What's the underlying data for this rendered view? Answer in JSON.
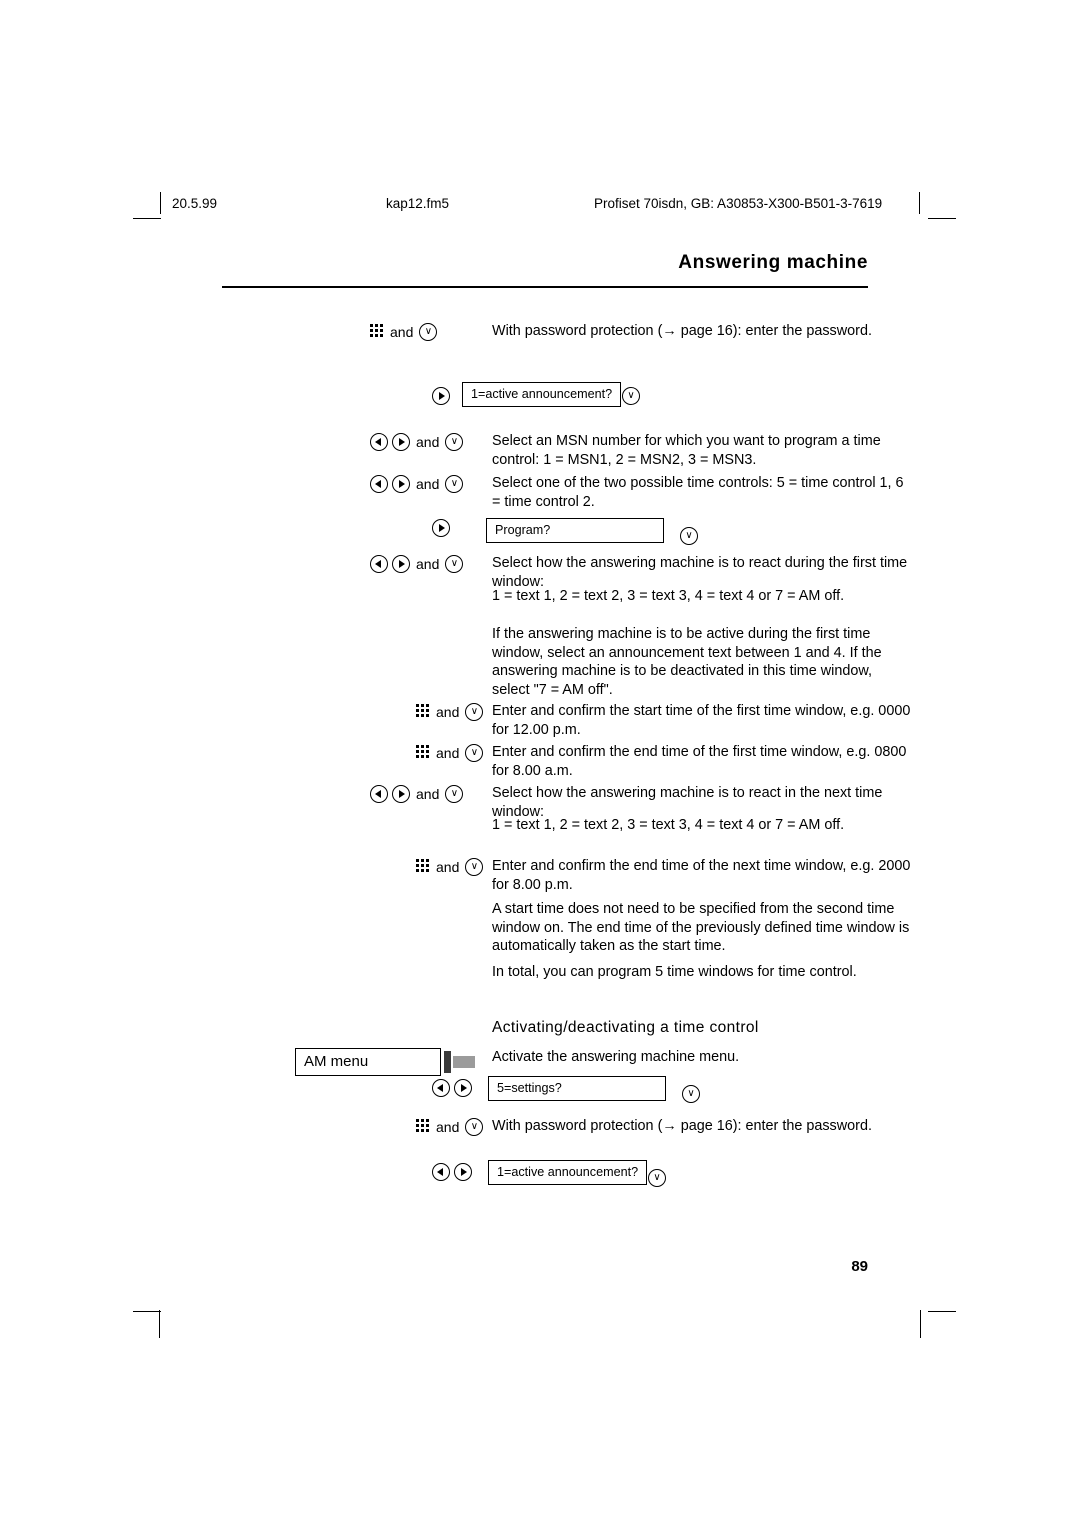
{
  "header": {
    "date": "20.5.99",
    "file": "kap12.fm5",
    "doc_id": "Profiset 70isdn, GB: A30853-X300-B501-3-7619"
  },
  "chapter_title": "Answering machine",
  "page_number": "89",
  "labels": {
    "and": "and"
  },
  "icons": {
    "keypad": "keypad-icon",
    "right": "right-arrow-key-icon",
    "left": "left-arrow-key-icon",
    "ok": "ok-confirm-key-icon"
  },
  "steps": [
    {
      "id": "password-1",
      "text": "With password protection (→ page 16): enter the password."
    },
    {
      "id": "active-announcement-1",
      "display": "1=active announcement?"
    },
    {
      "id": "select-msn",
      "text": "Select an MSN number for which you want to program a time control: 1 = MSN1, 2 = MSN2, 3 = MSN3."
    },
    {
      "id": "select-time-control",
      "text": "Select one of the two possible time controls: 5 = time control 1, 6 = time control 2."
    },
    {
      "id": "program",
      "display": "Program?"
    },
    {
      "id": "first-window-react",
      "text": "Select how the answering machine is to react during the first time window:",
      "text2": "1 = text 1, 2 = text 2, 3 = text 3, 4 = text 4 or 7 = AM off."
    },
    {
      "id": "note-first-window",
      "text": "If the answering machine is to be active during the first time window, select an announcement text between 1 and 4. If the answering machine is to be deactivated in this time window, select \"7 = AM off\"."
    },
    {
      "id": "start-time",
      "text": "Enter and confirm the start time of the first time window, e.g. 0000 for 12.00 p.m."
    },
    {
      "id": "end-time",
      "text": "Enter and confirm the end time of the first time window, e.g. 0800 for 8.00 a.m."
    },
    {
      "id": "next-window-react",
      "text": "Select how the answering machine is to react in the next time window:",
      "text2": "1 = text 1, 2 = text 2, 3 = text 3, 4 = text 4 or 7 = AM off."
    },
    {
      "id": "next-end-time",
      "text": "Enter and confirm the end time of the next time window, e.g. 2000 for 8.00 p.m."
    },
    {
      "id": "note-start-time",
      "text": "A start time does not need to be specified from the second time window on. The end time of the previously defined time window is automatically taken as the start time."
    },
    {
      "id": "note-total",
      "text": "In total, you can program 5 time windows for time control."
    }
  ],
  "section2": {
    "heading": "Activating/deactivating a time control",
    "softkey_label": "AM menu",
    "activate_text": "Activate the answering machine menu.",
    "settings_display": "5=settings?",
    "password_text": "With password protection (→ page 16): enter the password.",
    "announcement_display": "1=active announcement?"
  }
}
